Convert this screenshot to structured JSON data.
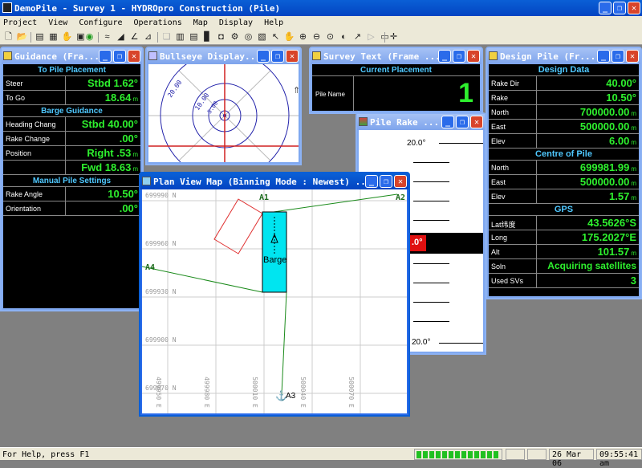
{
  "app": {
    "title": "DemoPile - Survey 1 - HYDROpro Construction (Pile)"
  },
  "menu": [
    "Project",
    "View",
    "Configure",
    "Operations",
    "Map",
    "Display",
    "Help"
  ],
  "guidance": {
    "title": "Guidance (Fra...",
    "to_pile_header": "To Pile Placement",
    "steer_label": "Steer",
    "steer_value": "Stbd 1.62°",
    "togo_label": "To Go",
    "togo_value": "18.64",
    "togo_unit": "m",
    "barge_header": "Barge Guidance",
    "heading_label": "Heading Chang",
    "heading_value": "Stbd 40.00°",
    "rake_label": "Rake Change",
    "rake_value": ".00°",
    "position_label": "Position",
    "position_value": "Right .53",
    "position_unit": "m",
    "fwd_value": "Fwd 18.63",
    "fwd_unit": "m",
    "manual_header": "Manual Pile Settings",
    "rakeangle_label": "Rake Angle",
    "rakeangle_value": "10.50°",
    "orient_label": "Orientation",
    "orient_value": ".00°"
  },
  "bullseye": {
    "title": "Bullseye Display...",
    "labels": [
      "20.00",
      "10.00",
      "5.00"
    ]
  },
  "survey_text": {
    "title": "Survey Text (Frame ...",
    "header": "Current Placement",
    "pile_label": "Pile Name",
    "pile_value": "1"
  },
  "pile_rake": {
    "title": "Pile Rake ...",
    "top_label": "20.0°",
    "bottom_label": "20.0°",
    "marker_label": ".0°"
  },
  "design_pile": {
    "title": "Design Pile (Fr...",
    "design_header": "Design Data",
    "rakedir_label": "Rake Dir",
    "rakedir_value": "40.00°",
    "rake_label": "Rake",
    "rake_value": "10.50°",
    "north_label": "North",
    "north_value": "700000.00",
    "unit_m": "m",
    "east_label": "East",
    "east_value": "500000.00",
    "elev_label": "Elev",
    "elev_value": "6.00",
    "centre_header": "Centre of Pile",
    "c_north_label": "North",
    "c_north_value": "699981.99",
    "c_east_label": "East",
    "c_east_value": "500000.00",
    "c_elev_label": "Elev",
    "c_elev_value": "1.57",
    "gps_header": "GPS",
    "lat_label": "Lat纬度",
    "lat_value": "43.5626°S",
    "long_label": "Long",
    "long_value": "175.2027°E",
    "alt_label": "Alt",
    "alt_value": "101.57",
    "soln_label": "Soln",
    "soln_value": "Acquiring satellites",
    "svs_label": "Used SVs",
    "svs_value": "3"
  },
  "planview": {
    "title": "Plan View Map (Binning Mode : Newest) ...",
    "north_labels": [
      "699990 N",
      "699960 N",
      "699930 N",
      "699900 N",
      "699870 N"
    ],
    "east_labels": [
      "499950 E",
      "499980 E",
      "500010 E",
      "500040 E",
      "500070 E"
    ],
    "marks": [
      "A1",
      "A2",
      "A4",
      "A3"
    ],
    "barge_label": "Barge"
  },
  "status": {
    "help": "For Help, press F1",
    "date": "26 Mar 06",
    "time": "09:55:41 am"
  }
}
